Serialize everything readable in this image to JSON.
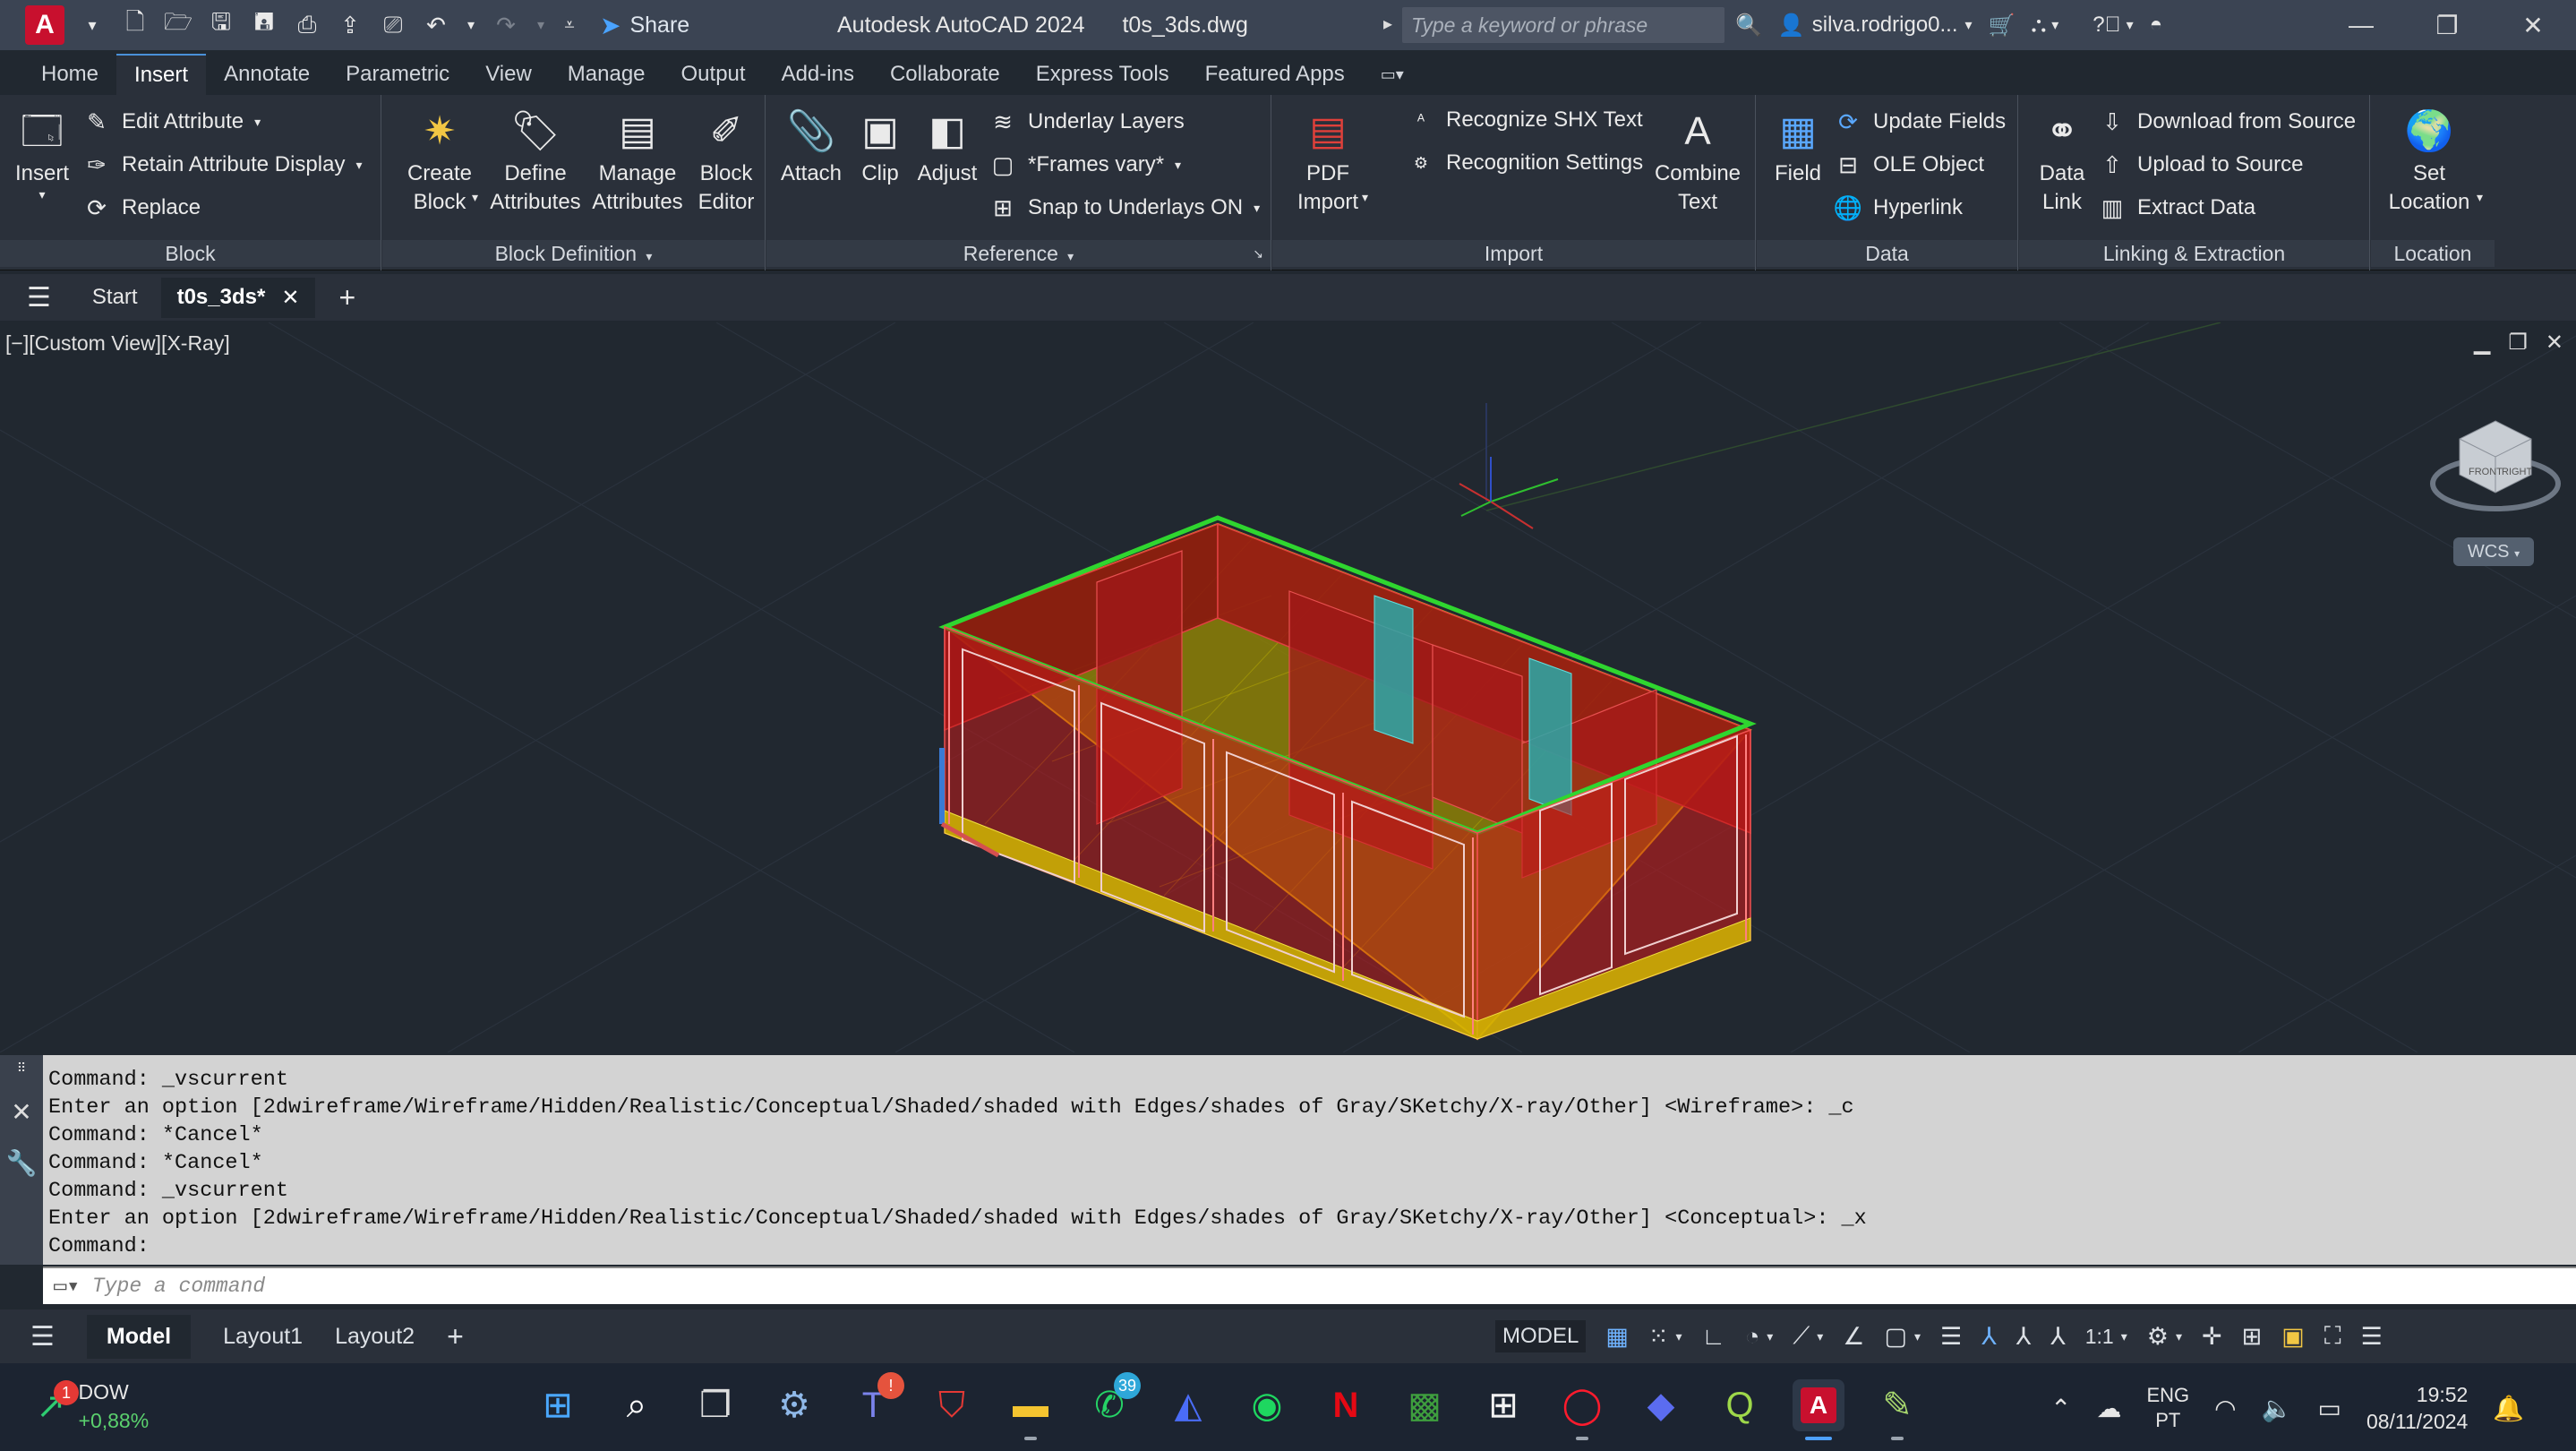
{
  "titlebar": {
    "app_logo": "A",
    "share_label": "Share",
    "app_title": "Autodesk AutoCAD 2024",
    "file_name": "t0s_3ds.dwg",
    "search_placeholder": "Type a keyword or phrase",
    "user_name": "silva.rodrigo0...",
    "icons": [
      "new-icon",
      "open-icon",
      "save-icon",
      "save-as-icon",
      "open-web-icon",
      "export-icon",
      "plot-icon",
      "undo-icon",
      "redo-icon"
    ]
  },
  "ribbon_tabs": [
    "Home",
    "Insert",
    "Annotate",
    "Parametric",
    "View",
    "Manage",
    "Output",
    "Add-ins",
    "Collaborate",
    "Express Tools",
    "Featured Apps"
  ],
  "active_tab": "Insert",
  "ribbon": {
    "block": {
      "title": "Block",
      "insert": "Insert",
      "edit_attribute": "Edit Attribute",
      "retain_attribute_display": "Retain Attribute Display",
      "replace": "Replace"
    },
    "block_definition": {
      "title": "Block Definition",
      "create_block": [
        "Create",
        "Block"
      ],
      "define_attributes": [
        "Define",
        "Attributes"
      ],
      "manage_attributes": [
        "Manage",
        "Attributes"
      ],
      "block_editor": [
        "Block",
        "Editor"
      ]
    },
    "reference": {
      "title": "Reference",
      "attach": "Attach",
      "clip": "Clip",
      "adjust": "Adjust",
      "underlay_layers": "Underlay Layers",
      "frames_vary": "*Frames vary*",
      "snap_to_underlays": "Snap to Underlays ON"
    },
    "import": {
      "title": "Import",
      "pdf_import": [
        "PDF",
        "Import"
      ],
      "recognize_shx_text": "Recognize SHX Text",
      "recognition_settings": "Recognition Settings",
      "combine_text": [
        "Combine",
        "Text"
      ]
    },
    "data": {
      "title": "Data",
      "field": "Field",
      "update_fields": "Update Fields",
      "ole_object": "OLE Object",
      "hyperlink": "Hyperlink"
    },
    "linking": {
      "title": "Linking & Extraction",
      "data_link": [
        "Data",
        "Link"
      ],
      "download_from_source": "Download from Source",
      "upload_to_source": "Upload to Source",
      "extract_data": "Extract  Data"
    },
    "location": {
      "title": "Location",
      "set_location": [
        "Set",
        "Location"
      ]
    }
  },
  "doc_tabs": {
    "start": "Start",
    "active": "t0s_3ds*"
  },
  "viewport": {
    "label": "[−][Custom View][X-Ray]",
    "wcs": "WCS",
    "viewcube_faces": [
      "FRONT",
      "RIGHT"
    ]
  },
  "command_history": [
    "Command: _vscurrent",
    "Enter an option [2dwireframe/Wireframe/Hidden/Realistic/Conceptual/Shaded/shaded with Edges/shades of Gray/SKetchy/X-ray/Other] <Wireframe>: _c",
    "Command: *Cancel*",
    "Command: *Cancel*",
    "Command: _vscurrent",
    "Enter an option [2dwireframe/Wireframe/Hidden/Realistic/Conceptual/Shaded/shaded with Edges/shades of Gray/SKetchy/X-ray/Other] <Conceptual>: _x",
    "Command:"
  ],
  "command_input_placeholder": "Type a command",
  "layout_tabs": [
    "Model",
    "Layout1",
    "Layout2"
  ],
  "status": {
    "model": "MODEL",
    "scale": "1:1"
  },
  "taskbar": {
    "ticker_name": "DOW",
    "ticker_change": "+0,88%",
    "weather_badge": "1",
    "whatsapp_badge": "39",
    "lang_1": "ENG",
    "lang_2": "PT",
    "time": "19:52",
    "date": "08/11/2024",
    "apps": [
      "start-icon",
      "search-icon",
      "task-view-icon",
      "settings-icon",
      "teams-icon",
      "mcafee-icon",
      "file-explorer-icon",
      "whatsapp-icon",
      "paint-icon",
      "spotify-icon",
      "netflix-icon",
      "minecraft-icon",
      "microsoft-store-icon",
      "opera-icon",
      "app-icon",
      "qgis-icon",
      "autocad-icon",
      "notepad-icon"
    ]
  },
  "colors": {
    "titlebar": "#3b4453",
    "ribbon": "#2a303a",
    "viewport": "#212830",
    "wall_red": "#b01818",
    "floor_yellow": "#c8b400",
    "roof_green": "#1fa51f",
    "glass_cyan": "#2aa9a9"
  }
}
